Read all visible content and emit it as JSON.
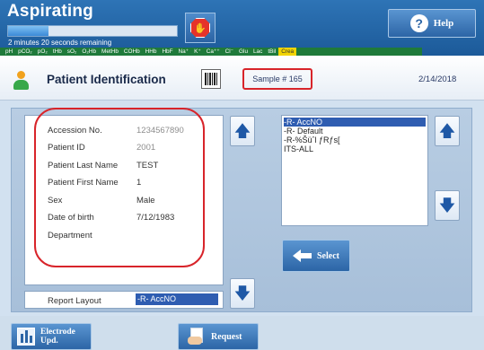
{
  "header": {
    "title": "Aspirating",
    "progress_fraction": 0.24,
    "remaining_text": "2 minutes 20 seconds remaining",
    "stop_icon": "stop-octagon-icon",
    "help_label": "Help",
    "help_icon": "help-icon"
  },
  "parameters": [
    "pH",
    "pCO₂",
    "pO₂",
    "tHb",
    "sO₂",
    "O₂Hb",
    "MetHb",
    "COHb",
    "HHb",
    "HbF",
    "Na⁺",
    "K⁺",
    "Ca⁺⁺",
    "Cl⁻",
    "Glu",
    "Lac",
    "tBil",
    "Crea"
  ],
  "highlighted_parameter": "Crea",
  "titlebar": {
    "title": "Patient Identification",
    "sample_label": "Sample # 165",
    "date": "2/14/2018"
  },
  "patient": {
    "fields": [
      {
        "label": "Accession No.",
        "value": "1234567890"
      },
      {
        "label": "Patient ID",
        "value": "2001"
      },
      {
        "label": "Patient Last Name",
        "value": "TEST"
      },
      {
        "label": "Patient First Name",
        "value": "1"
      },
      {
        "label": "Sex",
        "value": "Male"
      },
      {
        "label": "Date of birth",
        "value": "7/12/1983"
      },
      {
        "label": "Department",
        "value": ""
      }
    ]
  },
  "report_layout": {
    "label": "Report Layout",
    "value": "-R- AccNO"
  },
  "layout_list": {
    "items": [
      "-R- AccNO",
      "-R- Default",
      "-R-%Šüˆl ƒRƒs[",
      "ITS-ALL"
    ],
    "selected_index": 0
  },
  "buttons": {
    "select_label": "Select",
    "electrode_label_1": "Electrode",
    "electrode_label_2": "Upd.",
    "request_label": "Request"
  },
  "colors": {
    "header_blue": "#2e74b6",
    "highlight_red": "#d8242a",
    "selection_blue": "#2f5db1",
    "param_strip_green": "#1f7a3a",
    "param_highlight_yellow": "#f2d400"
  }
}
